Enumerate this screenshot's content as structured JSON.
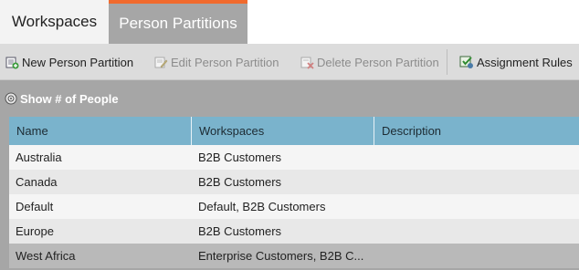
{
  "tabs": [
    {
      "label": "Workspaces",
      "active": false
    },
    {
      "label": "Person Partitions",
      "active": true
    }
  ],
  "toolbar": {
    "new_label": "New Person Partition",
    "edit_label": "Edit Person Partition",
    "delete_label": "Delete Person Partition",
    "rules_label": "Assignment Rules"
  },
  "show_people_label": "Show # of People",
  "table": {
    "columns": [
      "Name",
      "Workspaces",
      "Description"
    ],
    "rows": [
      {
        "name": "Australia",
        "workspaces": "B2B Customers",
        "description": ""
      },
      {
        "name": "Canada",
        "workspaces": "B2B Customers",
        "description": ""
      },
      {
        "name": "Default",
        "workspaces": "Default, B2B Customers",
        "description": ""
      },
      {
        "name": "Europe",
        "workspaces": "B2B Customers",
        "description": ""
      },
      {
        "name": "West Africa",
        "workspaces": "Enterprise Customers, B2B C...",
        "description": ""
      }
    ]
  },
  "colors": {
    "active_tab_accent": "#f16a2d",
    "header_blue": "#7ab3cc"
  }
}
